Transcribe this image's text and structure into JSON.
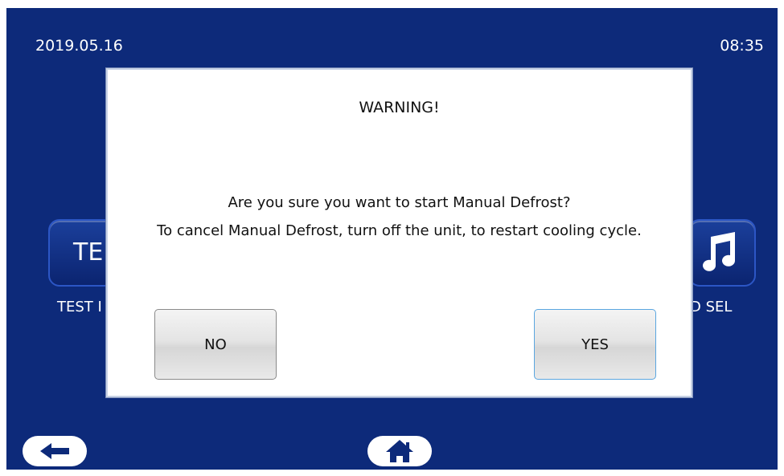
{
  "status_bar": {
    "date": "2019.05.16",
    "time": "08:35"
  },
  "background": {
    "left_tile_text": "TE",
    "left_tile_label": "TEST I",
    "right_tile_icon": "music-note-icon",
    "right_tile_label": "D SEL"
  },
  "dialog": {
    "title": "WARNING!",
    "message_line1": "Are you sure you want to start Manual Defrost?",
    "message_line2": "To cancel Manual Defrost, turn off the unit, to restart cooling cycle.",
    "no_label": "NO",
    "yes_label": "YES"
  },
  "nav": {
    "back_icon": "back-arrow-icon",
    "home_icon": "home-icon"
  },
  "colors": {
    "screen_bg": "#0d2a7a",
    "dialog_bg": "#ffffff",
    "yes_border": "#5aa6e0"
  }
}
